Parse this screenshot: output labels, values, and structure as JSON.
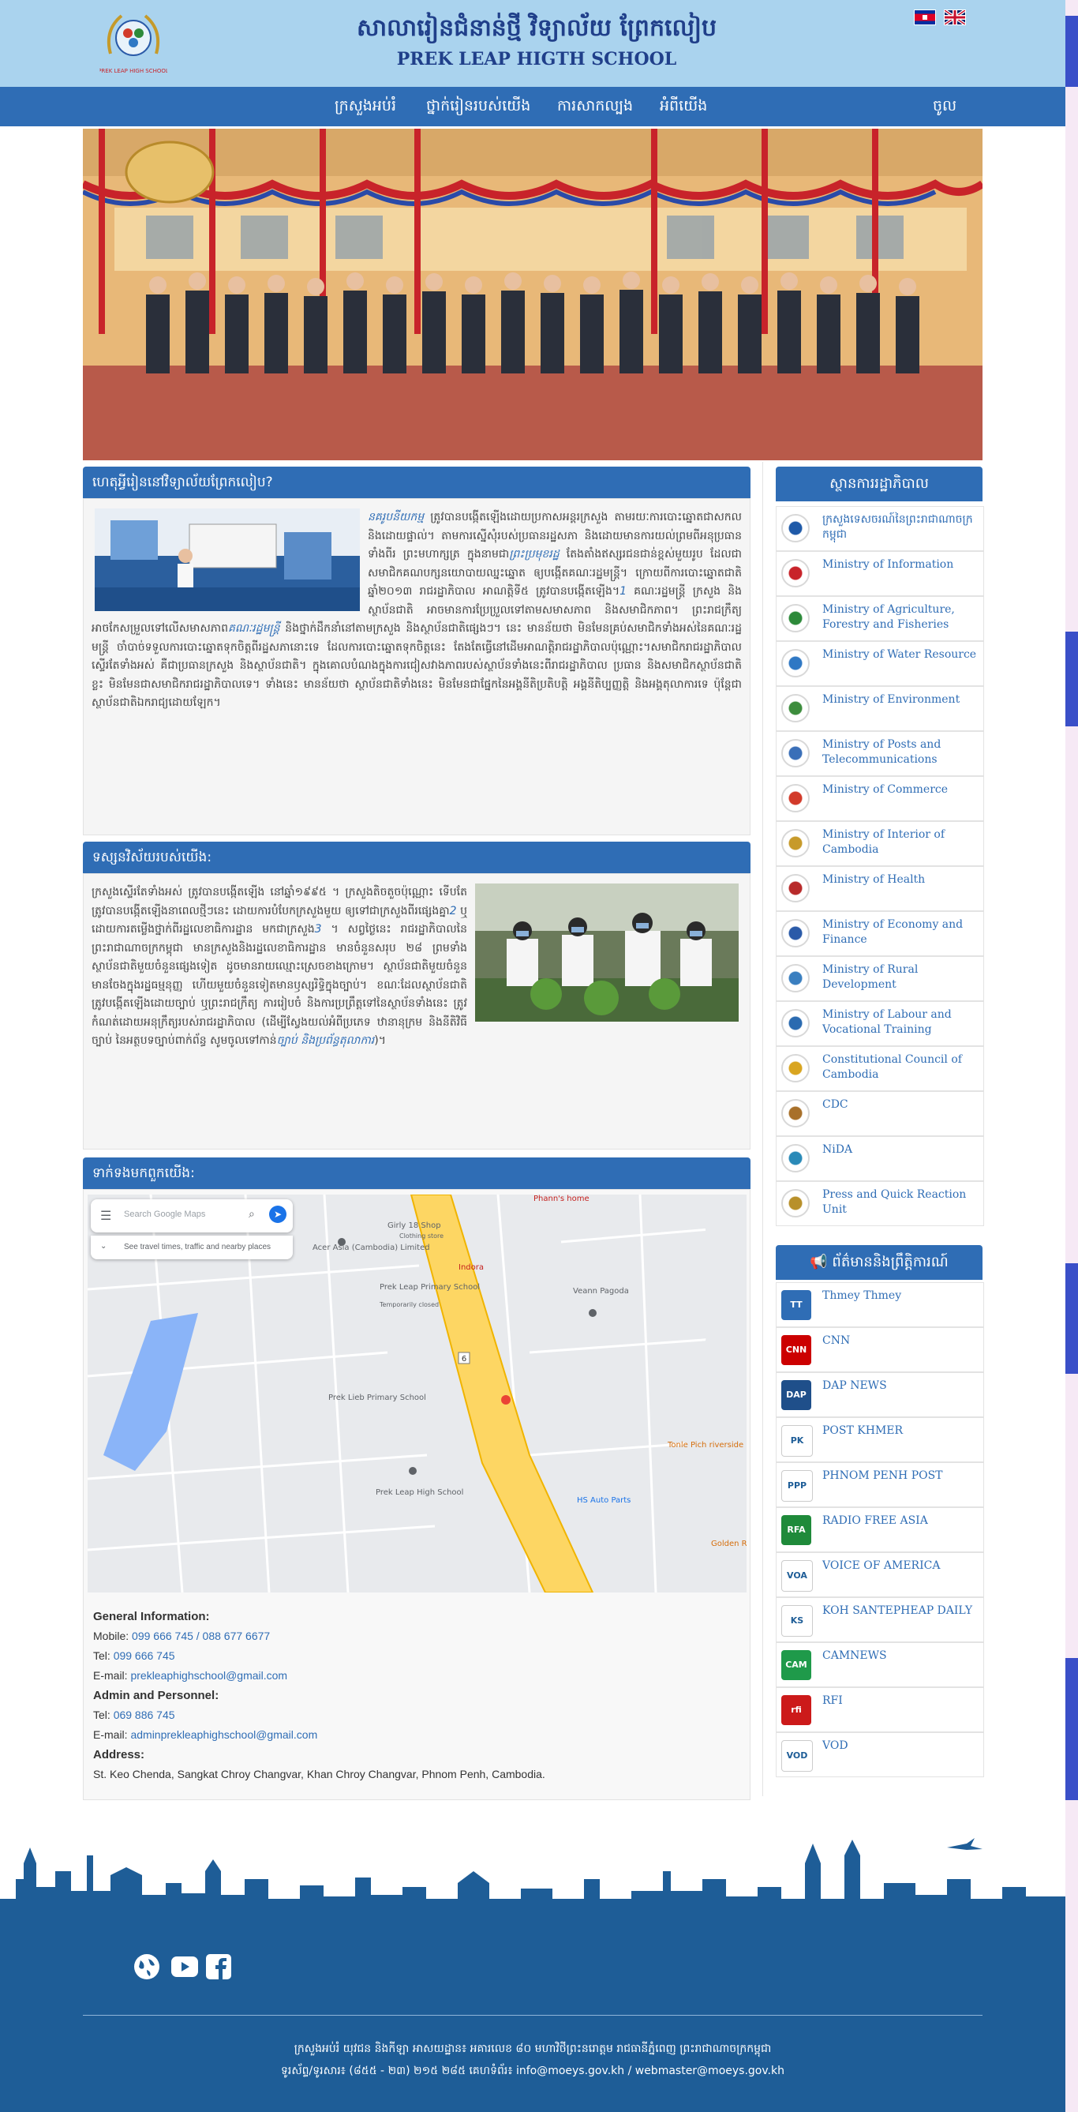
{
  "header": {
    "title_km": "សាលារៀនជំនាន់ថ្មី វិទ្យាល័យ ព្រែកលៀប",
    "title_en": "PREK LEAP HIGTH SCHOOL",
    "logo_caption": "PREK LEAP HIGH SCHOOL"
  },
  "nav": {
    "items": [
      "ក្រសួងអប់រំ",
      "ថ្នាក់រៀនរបស់យើង",
      "ការសាកល្បង",
      "អំពីយើង"
    ],
    "login": "ចូល"
  },
  "about": {
    "heading": "ហេតុអ្វីរៀននៅវិទ្យាល័យព្រែកលៀប?",
    "p_link1": "នគរូបនីយកម្ម",
    "p1": " ត្រូវបានបង្កើតឡើងដោយប្រកាសអន្តរក្រសួង តាមរយៈការបោះឆ្នោតជាសកល និងដោយផ្ទាល់។ តាមការស្នើសុំរបស់ប្រធានរដ្ឋសភា និងដោយមានការយល់ព្រមពីអនុប្រធានទាំងពីរ ព្រះមហាក្សត្រ ក្នុងនាមជា",
    "p_link2": "ព្រះប្រមុខរដ្ឋ",
    "p2": " តែងតាំងឥស្សរជនជាន់ខ្ពស់មួយរូប ដែលជាសមាជិកគណបក្សនយោបាយឈ្នះឆ្នោត ឲ្យបង្កើតគណៈរដ្ឋមន្ត្រី។ ក្រោយពីការបោះឆ្នោតជាតិឆ្នាំ២០១៣ រាជរដ្ឋាភិបាល អាណត្តិទី៥ ត្រូវបានបង្កើតឡើង។",
    "p_link3": "1",
    "p3": " គណៈរដ្ឋមន្ត្រី ក្រសួង និងស្ថាប័នជាតិ អាចមានការប្រែប្រួលទៅតាមសមាសភាព និងសមាជិកភាព។ ព្រះរាជក្រឹត្យ អាចកែសម្រួលទៅលើសមាសភាព",
    "p_link4": "គណៈរដ្ឋមន្ត្រី",
    "p4": " និងថ្នាក់ដឹកនាំនៅតាមក្រសួង និងស្ថាប័នជាតិផ្សេងៗ។ នេះ មានន័យថា មិនមែនគ្រប់សមាជិកទាំងអស់នៃគណៈរដ្ឋមន្ត្រី ចាំបាច់ទទួលការបោះឆ្នោតទុកចិត្តពីរដ្ឋសភានោះទេ ដែលការបោះឆ្នោតទុកចិត្តនេះ តែងតែធ្វើនៅដើមអាណត្តិរាជរដ្ឋាភិបាលប៉ុណ្ណោះ។សមាជិករាជរដ្ឋាភិបាលស្ទើរតែទាំងអស់ គឺជាប្រធានក្រសួង និងស្ថាប័នជាតិ។ ក្នុងគោលបំណងក្នុងការជៀសវាងភាពរបស់ស្ថាប័នទាំងនេះពីរាជរដ្ឋាភិបាល ប្រធាន និងសមាជិកស្ថាប័នជាតិខ្លះ មិនមែនជាសមាជិករាជរដ្ឋាភិបាលទេ។ ទាំងនេះ មានន័យថា ស្ថាប័នជាតិទាំងនេះ មិនមែនជាផ្នែកនៃអង្គនីតិប្រតិបត្តិ អង្គនីតិប្បញ្ញត្តិ និងអង្គតុលាការទេ ប៉ុន្តែជាស្ថាប័នជាតិឯករាជ្យដោយឡែក។"
  },
  "vision": {
    "heading": "ទស្សនវិស័យរបស់យើង:",
    "p1": "ក្រសួងស្ទើរតែទាំងអស់ ត្រូវបានបង្កើតឡើង នៅឆ្នាំ១៩៩៥ ។ ក្រសួងតិចតួចប៉ុណ្ណោះ ទើបតែត្រូវបានបង្កើតឡើងនាពេលថ្មីៗនេះ ដោយការបំបែកក្រសួងមួយ ឲ្យទៅជាក្រសួងពីរផ្សេងគ្នា",
    "link1": "2",
    "p2": " ឬដោយការតម្លើងថ្នាក់ពីរដ្ឋលេខាធិការដ្ឋាន មកជាក្រសួង",
    "link2": "3",
    "p3": " ។ សព្វថ្ងៃនេះ រាជរដ្ឋាភិបាលនៃព្រះរាជាណាចក្រកម្ពុជា មានក្រសួងនិងរដ្ឋលេខាធិការដ្ឋាន មានចំនួនសរុប ២៨ ព្រមទាំងស្ថាប័នជាតិមួយចំនួនផ្សេងទៀត ដូចមានរាយឈ្មោះស្រេចខាងក្រោម។ ស្ថាប័នជាតិមួយចំនួន មានចែងក្នុងរដ្ឋធម្មនុញ្ញ ហើយមួយចំនួនទៀតមានឫស្សរិទ្ធិក្នុងច្បាប់។ ខណៈដែលស្ថាប័នជាតិ ត្រូវបង្កើតឡើងដោយច្បាប់ ឬព្រះរាជក្រឹត្យ ការរៀបចំ និងការប្រព្រឹត្តទៅនៃស្ថាប័នទាំងនេះ ត្រូវកំណត់ដោយអនុក្រឹត្យរបស់រាជរដ្ឋាភិបាល (ដើម្បីស្វែងយល់អំពីប្រភេទ ឋានានុក្រម និងនីតិវិធីច្បាប់ នៃអត្ថបទច្បាប់ពាក់ព័ន្ធ សូមចូលទៅកាន់",
    "link3": "ច្បាប់ និងប្រព័ន្ធតុលាការ",
    "p4": ")។"
  },
  "contact": {
    "heading": "ទាក់ទងមកពួកយើង:",
    "map": {
      "search_placeholder": "Search Google Maps",
      "travel_hint": "See travel times, traffic and nearby places",
      "labels": [
        "Girly 18 Shop",
        "Clothing store",
        "Acer Asia (Cambodia) Limited",
        "Indora",
        "Veann Pagoda",
        "Prek Leap Primary School",
        "Temporarily closed",
        "Prek Lieb Primary School",
        "Prek Leap High School",
        "HS Auto Parts",
        "Tonle Pich riverside",
        "Golden Riv",
        "Phann's home",
        "6"
      ]
    },
    "general_title": "General Information:",
    "mobile_label": "Mobile: ",
    "mobile": "099 666 745 / 088 677 6677",
    "tel_label": "Tel: ",
    "tel": "099 666 745",
    "email_label": "E-mail: ",
    "email": "prekleaphighschool@gmail.com",
    "admin_title": "Admin and Personnel:",
    "admin_tel": "069 886 745",
    "admin_email": "adminprekleaphighschool@gmail.com",
    "address_title": "Address:",
    "address": "St. Keo Chenda, Sangkat Chroy Changvar, Khan Chroy Changvar, Phnom Penh, Cambodia."
  },
  "sidebar": {
    "gov_heading": "ស្ថានការរដ្ឋាភិបាល",
    "gov_items": [
      {
        "label": "ក្រសួងទេសចរណ៍នៃព្រះរាជាណាចក្រកម្ពុជា",
        "color": "#1f5aa8"
      },
      {
        "label": "Ministry of Information",
        "color": "#c8232a"
      },
      {
        "label": "Ministry of Agriculture, Forestry and Fisheries",
        "color": "#2d8a3a"
      },
      {
        "label": "Ministry of Water Resource",
        "color": "#2f78c4"
      },
      {
        "label": "Ministry of Environment",
        "color": "#3d8d3d"
      },
      {
        "label": "Ministry of Posts and Telecommunications",
        "color": "#3a6fb8"
      },
      {
        "label": "Ministry of Commerce",
        "color": "#d23a2a"
      },
      {
        "label": "Ministry of Interior of Cambodia",
        "color": "#c79a2a"
      },
      {
        "label": "Ministry of Health",
        "color": "#b82a2a"
      },
      {
        "label": "Ministry of Economy and Finance",
        "color": "#2a5aa8"
      },
      {
        "label": "Ministry of Rural Development",
        "color": "#3a7fc0"
      },
      {
        "label": "Ministry of Labour and Vocational Training",
        "color": "#2a6ab0"
      },
      {
        "label": "Constitutional Council of Cambodia",
        "color": "#d9a520"
      },
      {
        "label": "CDC",
        "color": "#a8702a"
      },
      {
        "label": "NiDA",
        "color": "#2a8ab8"
      },
      {
        "label": "Press and Quick Reaction Unit",
        "color": "#b8902a"
      }
    ],
    "news_heading": "ព័ត៌មាននិងព្រឹត្តិការណ៍",
    "news_items": [
      {
        "label": "Thmey Thmey",
        "color": "#2f6db5",
        "abbr": "TT"
      },
      {
        "label": "CNN",
        "color": "#cc0000",
        "abbr": "CNN"
      },
      {
        "label": "DAP NEWS",
        "color": "#1f4f8a",
        "abbr": "DAP"
      },
      {
        "label": "POST KHMER",
        "color": "#ffffff",
        "abbr": "PK"
      },
      {
        "label": "PHNOM PENH POST",
        "color": "#ffffff",
        "abbr": "PPP"
      },
      {
        "label": "RADIO FREE ASIA",
        "color": "#1f8a3a",
        "abbr": "RFA"
      },
      {
        "label": "VOICE OF AMERICA",
        "color": "#ffffff",
        "abbr": "VOA"
      },
      {
        "label": "KOH SANTEPHEAP DAILY",
        "color": "#ffffff",
        "abbr": "KS"
      },
      {
        "label": "CAMNEWS",
        "color": "#1f9a4a",
        "abbr": "CAM"
      },
      {
        "label": "RFI",
        "color": "#cc1a1a",
        "abbr": "rfi"
      },
      {
        "label": "VOD",
        "color": "#ffffff",
        "abbr": "VOD"
      }
    ]
  },
  "footer": {
    "line1": "ក្រសួងអប់រំ យុវជន និងកីឡា អាសយដ្ឋាន៖ អគារលេខ ៨០ មហាវិថីព្រះនរោត្តម រាជធានីភ្នំពេញ ព្រះរាជាណាចក្រកម្ពុជា",
    "line2": "ទូរស័ព្ទ/ទូរសារ៖ (៨៥៥ - ២៣) ២១៥ ២៨៥ គេហទំព័រ៖ info@moeys.gov.kh / webmaster@moeys.gov.kh"
  },
  "colors": {
    "header_bg": "#aad3ee",
    "nav_bg": "#2f6db5",
    "title": "#203f8a",
    "footer_bg": "#1e5d97"
  }
}
